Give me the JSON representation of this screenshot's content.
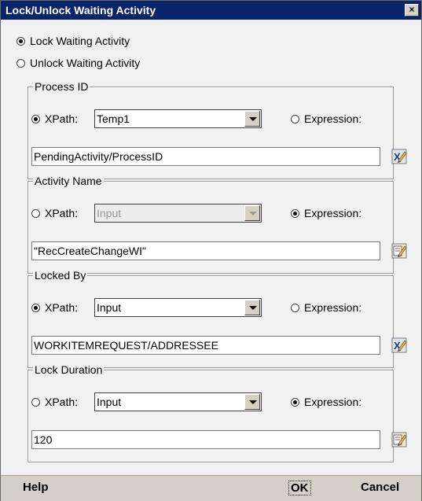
{
  "window": {
    "title": "Lock/Unlock Waiting Activity",
    "close_glyph": "×"
  },
  "mode": {
    "lock_label": "Lock Waiting Activity",
    "unlock_label": "Unlock Waiting Activity",
    "selected": "lock"
  },
  "groups": [
    {
      "legend": "Process ID",
      "xpath_label": "XPath:",
      "expression_label": "Expression:",
      "selected": "xpath",
      "combo_value": "Temp1",
      "combo_enabled": true,
      "text_value": "PendingActivity/ProcessID",
      "icon": "xpath-editor-icon"
    },
    {
      "legend": "Activity Name",
      "xpath_label": "XPath:",
      "expression_label": "Expression:",
      "selected": "expression",
      "combo_value": "Input",
      "combo_enabled": false,
      "text_value": "\"RecCreateChangeWI\"",
      "icon": "expression-editor-icon"
    },
    {
      "legend": "Locked By",
      "xpath_label": "XPath:",
      "expression_label": "Expression:",
      "selected": "xpath",
      "combo_value": "Input",
      "combo_enabled": true,
      "text_value": "WORKITEMREQUEST/ADDRESSEE",
      "icon": "xpath-editor-icon"
    },
    {
      "legend": "Lock Duration",
      "xpath_label": "XPath:",
      "expression_label": "Expression:",
      "selected": "expression",
      "combo_value": "Input",
      "combo_enabled": true,
      "text_value": "120",
      "icon": "expression-editor-icon"
    }
  ],
  "footer": {
    "help_label": "Help",
    "ok_label": "OK",
    "cancel_label": "Cancel"
  }
}
